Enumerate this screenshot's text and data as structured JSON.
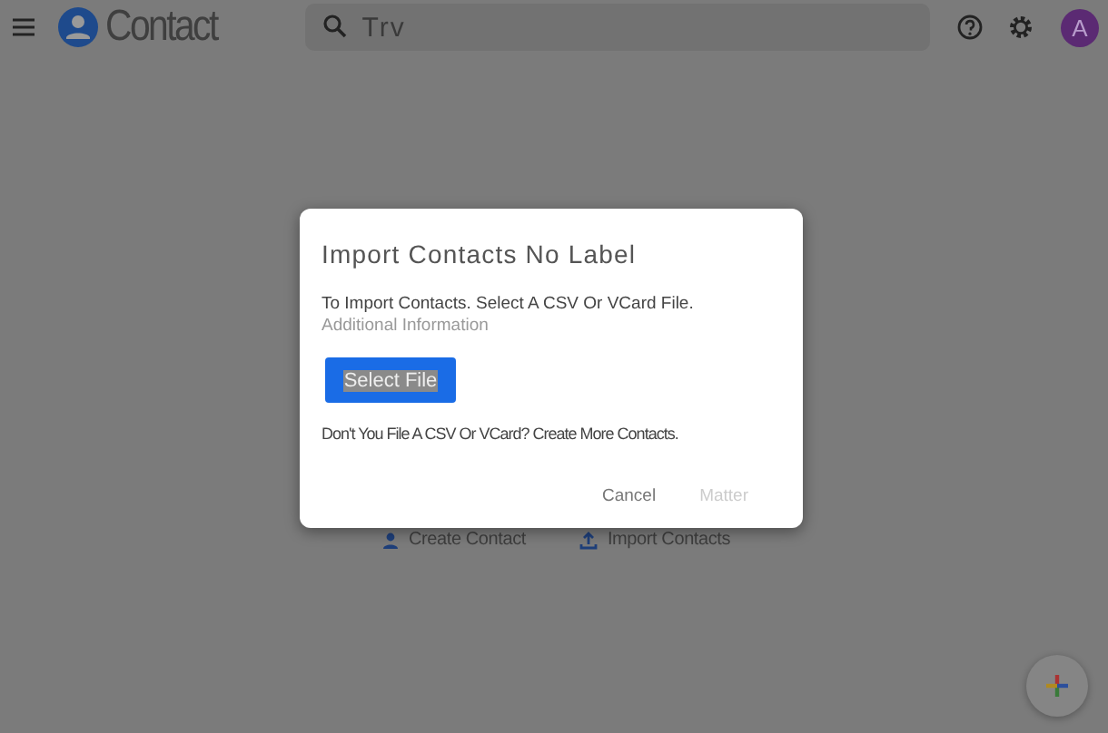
{
  "header": {
    "title": "Contact",
    "search": {
      "placeholder": "Trv"
    },
    "avatar": "A"
  },
  "page_actions": [
    {
      "label": "Create Contact",
      "kind": "create"
    },
    {
      "label": "Import Contacts",
      "kind": "import"
    }
  ],
  "dialog": {
    "title": "Import Contacts No Label",
    "instruction": "To Import Contacts. Select A CSV Or VCard File.",
    "info_link": "Additional Information",
    "select_button": "Select File",
    "hint": "Don't You File A CSV Or VCard? Create More Contacts.",
    "buttons": [
      {
        "label": "Cancel",
        "disabled": false
      },
      {
        "label": "Matter",
        "disabled": true
      }
    ]
  }
}
